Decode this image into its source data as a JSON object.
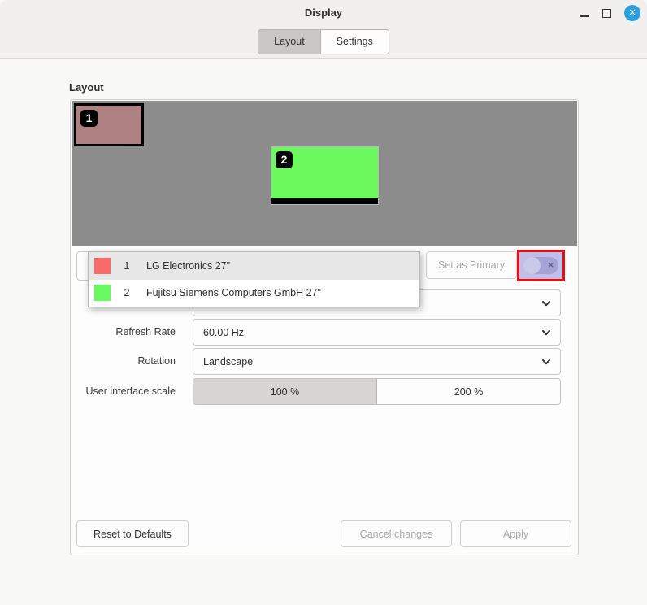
{
  "window": {
    "title": "Display",
    "controls": {
      "close_glyph": "✕"
    }
  },
  "tabs": [
    {
      "label": "Layout"
    },
    {
      "label": "Settings"
    }
  ],
  "section_heading": "Layout",
  "canvas": {
    "background": "#8c8c8c",
    "monitors": [
      {
        "number": "1",
        "color": "#b08182"
      },
      {
        "number": "2",
        "color": "#6cf95e"
      }
    ]
  },
  "monitor_menu": {
    "items": [
      {
        "number": "1",
        "name": "LG Electronics 27\"",
        "swatch": "#fa6a6a"
      },
      {
        "number": "2",
        "name": "Fujitsu Siemens Computers GmbH 27\"",
        "swatch": "#67f95e"
      }
    ]
  },
  "primary_button": {
    "label": "Set as Primary"
  },
  "toggle": {
    "state": "off",
    "glyph": "✕",
    "highlight_color": "#e60f0f"
  },
  "rows": {
    "refresh": {
      "label": "Refresh Rate",
      "value": "60.00 Hz"
    },
    "rotation": {
      "label": "Rotation",
      "value": "Landscape"
    }
  },
  "scale": {
    "label": "User interface scale",
    "options": [
      {
        "label": "100 %"
      },
      {
        "label": "200 %"
      }
    ]
  },
  "footer": {
    "reset": "Reset to Defaults",
    "cancel": "Cancel changes",
    "apply": "Apply"
  }
}
